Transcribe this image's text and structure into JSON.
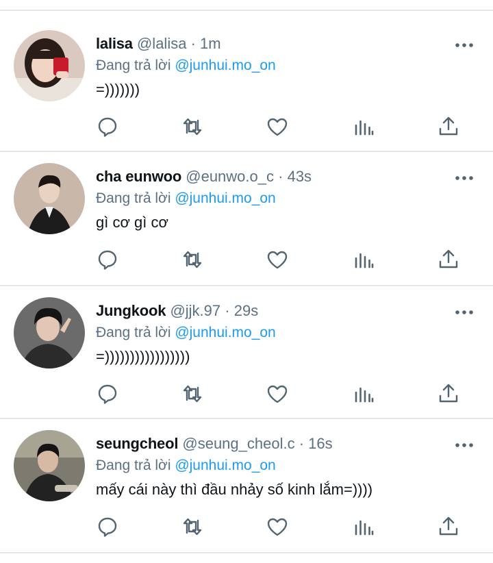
{
  "tweets": [
    {
      "name": "lalisa",
      "handle": "@lalisa",
      "dot": "·",
      "time": "1m",
      "reply_prefix": "Đang trả lời",
      "reply_to": "@junhui.mo_on",
      "text": "=)))))))",
      "avatar_colors": {
        "bg": "#d9c9bf",
        "hair": "#2a1d18",
        "skin": "#f1d4c3",
        "accent": "#c81c2c"
      }
    },
    {
      "name": "cha eunwoo",
      "handle": "@eunwo.o_c",
      "dot": "·",
      "time": "43s",
      "reply_prefix": "Đang trả lời",
      "reply_to": "@junhui.mo_on",
      "text": "gì cơ gì cơ",
      "avatar_colors": {
        "bg": "#c9b7a9",
        "hair": "#1b1412",
        "skin": "#ead2c3",
        "accent": "#1c1c1c"
      }
    },
    {
      "name": "Jungkook",
      "handle": "@jjk.97",
      "dot": "·",
      "time": "29s",
      "reply_prefix": "Đang trả lời",
      "reply_to": "@junhui.mo_on",
      "text": "=)))))))))))))))))",
      "avatar_colors": {
        "bg": "#6b6b6b",
        "hair": "#141414",
        "skin": "#e3c6b4",
        "accent": "#2b2b2b"
      }
    },
    {
      "name": "seungcheol",
      "handle": "@seung_cheol.c",
      "dot": "·",
      "time": "16s",
      "reply_prefix": "Đang trả lời",
      "reply_to": "@junhui.mo_on",
      "text": "mấy cái này thì đầu nhảy số kinh lắm=))))",
      "avatar_colors": {
        "bg": "#7d7a70",
        "hair": "#161412",
        "skin": "#d8b9a3",
        "accent": "#222222"
      }
    }
  ],
  "icons": {
    "more": "more-horizontal-icon",
    "reply": "reply-bubble-icon",
    "retweet": "retweet-icon",
    "like": "heart-icon",
    "views": "bar-chart-icon",
    "share": "share-icon"
  },
  "colors": {
    "icon": "#536471",
    "mention": "#1d9bf0",
    "secondary": "#5b7083",
    "divider": "#e6e6e6"
  }
}
